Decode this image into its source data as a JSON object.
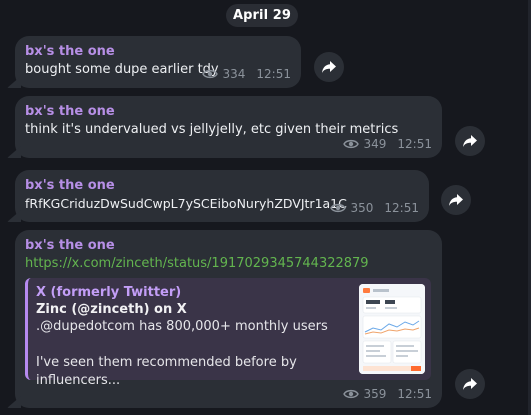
{
  "date_divider": "April 29",
  "colors": {
    "background": "#16181e",
    "bubble": "#2b2f36",
    "sender": "#b78fe6",
    "link": "#63b54f",
    "meta": "#8b929b",
    "preview_accent": "#b68af0"
  },
  "messages": [
    {
      "sender": "bx's the one",
      "text": "bought some dupe earlier tdy",
      "views": "334",
      "time": "12:51",
      "share_icon": "forward-arrow-icon"
    },
    {
      "sender": "bx's the one",
      "text": "think it's undervalued vs jellyjelly, etc given their metrics",
      "views": "349",
      "time": "12:51",
      "share_icon": "forward-arrow-icon"
    },
    {
      "sender": "bx's the one",
      "text": "fRfKGCriduzDwSudCwpL7ySCEiboNuryhZDVJtr1a1C",
      "views": "350",
      "time": "12:51",
      "share_icon": "forward-arrow-icon"
    },
    {
      "sender": "bx's the one",
      "link": "https://x.com/zinceth/status/1917029345744322879",
      "preview": {
        "site": "X (formerly Twitter)",
        "title": "Zinc (@zinceth) on X",
        "description": ".@dupedotcom has 800,000+ monthly users\n\nI've seen them recommended before by influencers..."
      },
      "views": "359",
      "time": "12:51",
      "share_icon": "forward-arrow-icon"
    }
  ]
}
